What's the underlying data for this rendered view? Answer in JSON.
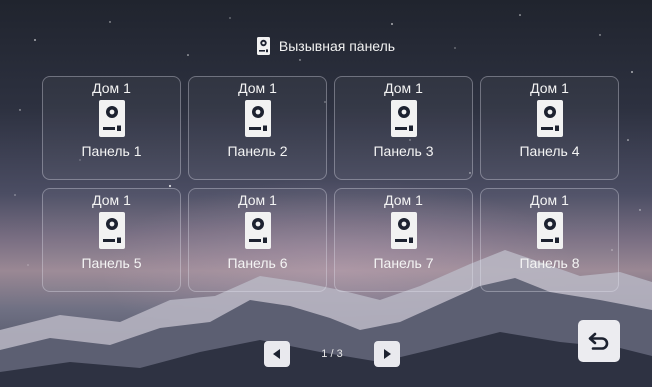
{
  "header": {
    "title": "Вызывная панель",
    "icon": "door-panel-icon"
  },
  "panels": [
    {
      "house": "Дом 1",
      "name": "Панель 1"
    },
    {
      "house": "Дом 1",
      "name": "Панель 2"
    },
    {
      "house": "Дом 1",
      "name": "Панель 3"
    },
    {
      "house": "Дом 1",
      "name": "Панель 4"
    },
    {
      "house": "Дом 1",
      "name": "Панель 5"
    },
    {
      "house": "Дом 1",
      "name": "Панель 6"
    },
    {
      "house": "Дом 1",
      "name": "Панель 7"
    },
    {
      "house": "Дом 1",
      "name": "Панель 8"
    }
  ],
  "pagination": {
    "indicator": "1 / 3",
    "prev_icon": "triangle-left-icon",
    "next_icon": "triangle-right-icon"
  },
  "back_button": {
    "icon": "return-arrow-icon"
  },
  "colors": {
    "text": "#f4f4f4",
    "button_bg": "#e9e9ee",
    "icon_dark": "#1d2230"
  }
}
